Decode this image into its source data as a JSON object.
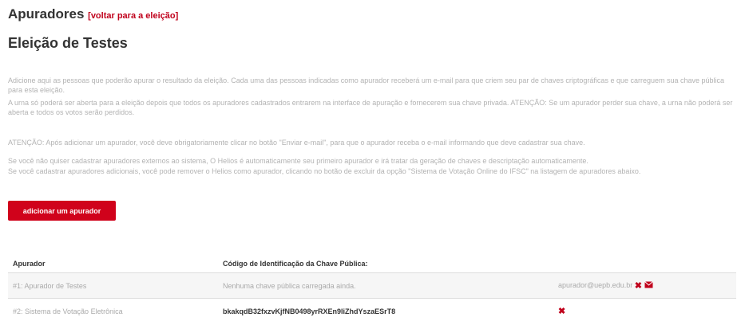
{
  "header": {
    "title": "Apuradores",
    "back_link": "[voltar para a eleição]",
    "election_name": "Eleição de Testes"
  },
  "paragraphs": [
    "Adicione aqui as pessoas que poderão apurar o resultado da eleição. Cada uma das pessoas indicadas como apurador receberá um e-mail para que criem seu par de chaves criptográficas e que carreguem sua chave pública para esta eleição.",
    "A urna só poderá ser aberta para a eleição depois que todos os apuradores cadastrados entrarem na interface de apuração e fornecerem sua chave privada. ATENÇÃO: Se um apurador perder sua chave, a urna não poderá ser aberta e todos os votos serão perdidos.",
    "ATENÇÃO: Após adicionar um apurador, você deve obrigatoriamente clicar no botão \"Enviar e-mail\", para que o apurador receba o e-mail informando que deve cadastrar sua chave.",
    "Se você não quiser cadastrar apuradores externos ao sistema, O Helios é automaticamente seu primeiro apurador e irá tratar da geração de chaves e descriptação automaticamente.",
    "Se você cadastrar apuradores adicionais, você pode remover o Helios como apurador, clicando no botão de excluir da opção \"Sistema de Votação Online do IFSC\" na listagem de apuradores abaixo."
  ],
  "add_button": "adicionar um apurador",
  "table": {
    "headers": [
      "Apurador",
      "Código de Identificação da Chave Pública:"
    ],
    "rows": [
      {
        "name": "#1: Apurador de Testes",
        "key": "Nenhuma chave pública carregada ainda.",
        "email": "apurador@uepb.edu.br"
      },
      {
        "name": "#2: Sistema de Votação Eletrônica",
        "key": "bkakqdB32fxzvKjfNB0498yrRXEn9IiZhdYszaESrT8",
        "email": ""
      }
    ]
  },
  "icons": {
    "delete": "close-x-icon",
    "email": "envelope-icon"
  },
  "colors": {
    "accent": "#d0021b",
    "link": "#c0001b"
  }
}
